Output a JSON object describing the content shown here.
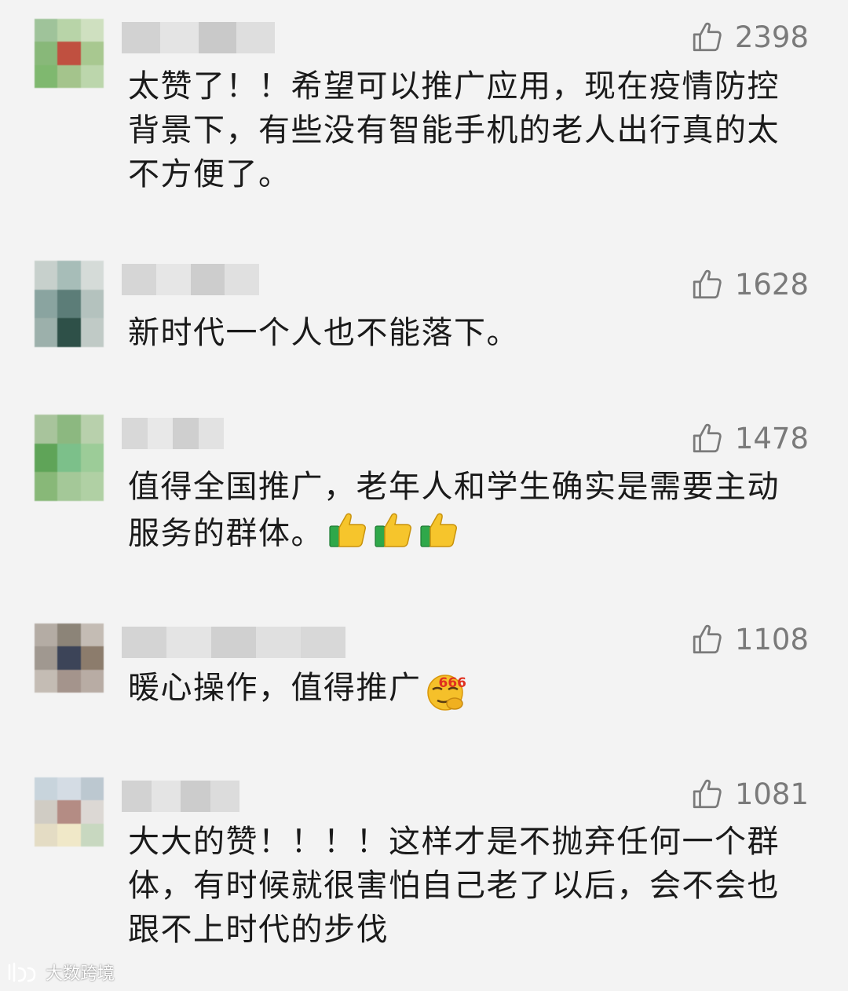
{
  "comments": [
    {
      "likes": "2398",
      "text": " 太赞了！！希望可以推广应用，现在疫情防控背景下，有些没有智能手机的老人出行真的太不方便了。",
      "avatar_colors": [
        "#9fc39a",
        "#b8d4a8",
        "#cfe0c0",
        "#88b879",
        "#c05040",
        "#a8c890",
        "#7fb86f",
        "#a4c48c",
        "#bcd6ac"
      ],
      "nick_colors": [
        "#d2d2d2",
        "#e4e4e4",
        "#c9c9c9",
        "#dedede"
      ]
    },
    {
      "likes": "1628",
      "text": "新时代一个人也不能落下。",
      "avatar_colors": [
        "#c7d0cc",
        "#a7bdb8",
        "#d5dbd8",
        "#8aa4a0",
        "#5c7d78",
        "#b4c2be",
        "#9cb0ab",
        "#2e5048",
        "#c0cac6"
      ],
      "nick_colors": [
        "#d6d6d6",
        "#e6e6e6",
        "#cdcdcd",
        "#e0e0e0"
      ]
    },
    {
      "likes": "1478",
      "text": "值得全国推广，老年人和学生确实是需要主动服务的群体。",
      "emoji": "thumbs-up",
      "emoji_count": 3,
      "avatar_colors": [
        "#a8c49c",
        "#8cb880",
        "#b8d0ac",
        "#5fa458",
        "#7cc08a",
        "#9ccc98",
        "#88b878",
        "#a4c898",
        "#b0d0a4"
      ],
      "nick_colors": [
        "#d8d8d8",
        "#e8e8e8",
        "#cfcfcf",
        "#e2e2e2"
      ]
    },
    {
      "likes": "1108",
      "text": "暖心操作，值得推广",
      "emoji": "666-face",
      "emoji_label": "666",
      "avatar_colors": [
        "#b4aca4",
        "#8c8478",
        "#c4bcb4",
        "#a09890",
        "#3c4458",
        "#8c7c6c",
        "#c4bcb4",
        "#a4948c",
        "#b8aca4"
      ],
      "nick_colors": [
        "#d4d4d4",
        "#e4e4e4",
        "#d0d0d0",
        "#e0e0e0",
        "#d8d8d8"
      ]
    },
    {
      "likes": "1081",
      "text": "大大的赞！！！！这样才是不抛弃任何一个群体，有时候就很害怕自己老了以后，会不会也跟不上时代的步伐",
      "avatar_colors": [
        "#c8d4dc",
        "#d4dce4",
        "#bcc8d0",
        "#d0ccc4",
        "#b48c84",
        "#dcd8d4",
        "#e4dcc4",
        "#f0e8c8",
        "#c8d8c0"
      ],
      "nick_colors": [
        "#d2d2d2",
        "#e4e4e4",
        "#cccccc",
        "#dcdcdc"
      ]
    }
  ],
  "watermark": {
    "icon": "bilibili-style-logo-icon",
    "text": "大数跨境"
  },
  "colors": {
    "background": "#f3f3f3",
    "text": "#1a1a1a",
    "like_count": "#7a7a7a"
  }
}
